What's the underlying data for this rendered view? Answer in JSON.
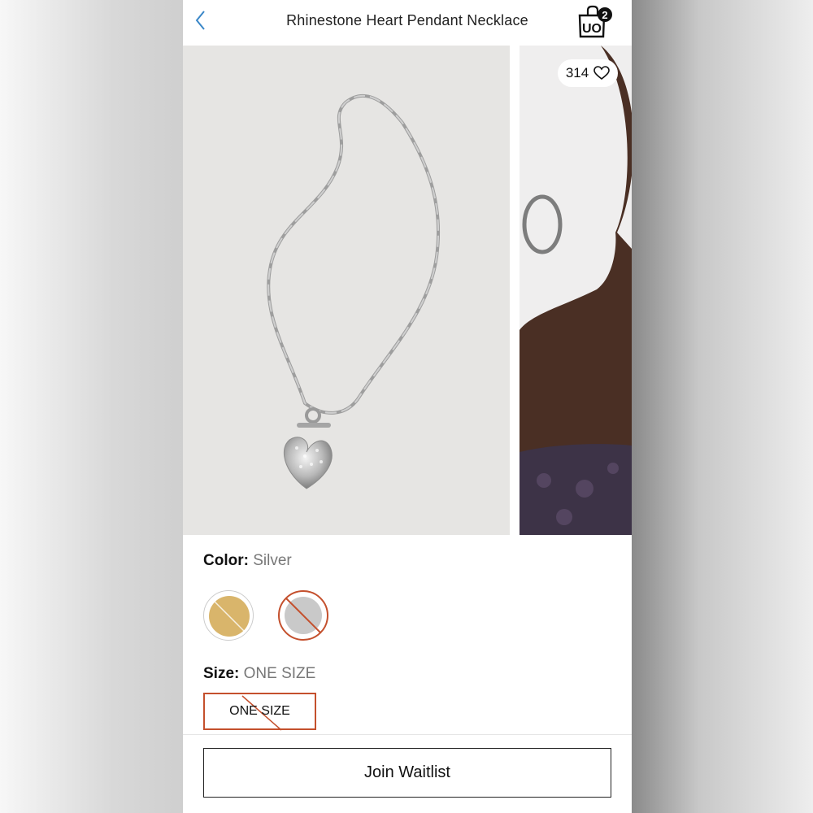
{
  "header": {
    "title": "Rhinestone Heart Pendant Necklace",
    "cart_count": "2",
    "bag_logo_text": "UO"
  },
  "gallery": {
    "like_count": "314"
  },
  "options": {
    "color_key": "Color:",
    "color_value": "Silver",
    "size_key": "Size:",
    "size_value": "ONE SIZE",
    "size_button_label": "ONE SIZE",
    "swatches": [
      {
        "name": "gold",
        "color": "#d9b56b",
        "available": false
      },
      {
        "name": "silver",
        "color": "#c9c9c9",
        "available": false,
        "selected": true
      }
    ]
  },
  "cta": {
    "waitlist_label": "Join Waitlist"
  },
  "colors": {
    "accent_blue": "#3a87c8",
    "unavailable_red": "#c4502d"
  }
}
